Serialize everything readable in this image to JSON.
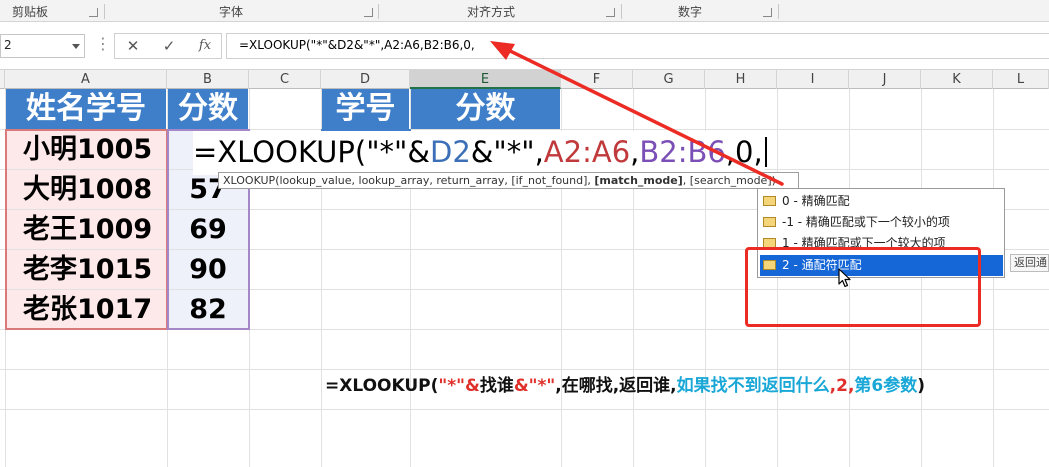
{
  "ribbon": {
    "groups": [
      "剪贴板",
      "字体",
      "对齐方式",
      "数字"
    ]
  },
  "formula_bar": {
    "name_box": "2",
    "cancel_icon": "✕",
    "enter_icon": "✓",
    "fx_label": "fx",
    "formula": "=XLOOKUP(\"*\"&D2&\"*\",A2:A6,B2:B6,0,"
  },
  "columns": [
    "A",
    "B",
    "C",
    "D",
    "E",
    "F",
    "G",
    "H",
    "I",
    "J",
    "K",
    "L"
  ],
  "table1": {
    "header_name": "姓名学号",
    "header_score": "分数",
    "rows": [
      {
        "name": "小明1005",
        "score": ""
      },
      {
        "name": "大明1008",
        "score": "57"
      },
      {
        "name": "老王1009",
        "score": "69"
      },
      {
        "name": "老李1015",
        "score": "90"
      },
      {
        "name": "老张1017",
        "score": "82"
      }
    ]
  },
  "table2": {
    "header_id": "学号",
    "header_score": "分数"
  },
  "cell_editor": {
    "p1": "=XLOOKUP(\"*\"&",
    "p2": "D2",
    "p3": "&\"*\",",
    "p4": "A2:A6",
    "p5": ",",
    "p6": "B2:B6",
    "p7": ",0,"
  },
  "tooltip": {
    "prefix": "XLOOKUP(lookup_value, lookup_array, return_array, [if_not_found], ",
    "bold": "[match_mode]",
    "suffix": ", [search_mode])"
  },
  "dropdown": {
    "items": [
      {
        "label": "0 - 精确匹配"
      },
      {
        "label": "-1 - 精确匹配或下一个较小的项"
      },
      {
        "label": "1 - 精确匹配或下一个较大的项"
      },
      {
        "label": "2 - 通配符匹配"
      }
    ],
    "side_tip": "返回通"
  },
  "note": {
    "a": "=XLOOKUP(",
    "b": "\"*\"&",
    "c": "找谁",
    "d": "&\"*\"",
    "e": ",在哪找,返回谁,",
    "f": "如果找不到返回什么",
    "g": ",",
    "h": "2",
    "i": ",",
    "j": "第6参数",
    "k": ")"
  },
  "colors": {
    "header_blue": "#3f7ec9",
    "annotation_red": "#ec2b24",
    "selection_blue": "#1566d6"
  }
}
